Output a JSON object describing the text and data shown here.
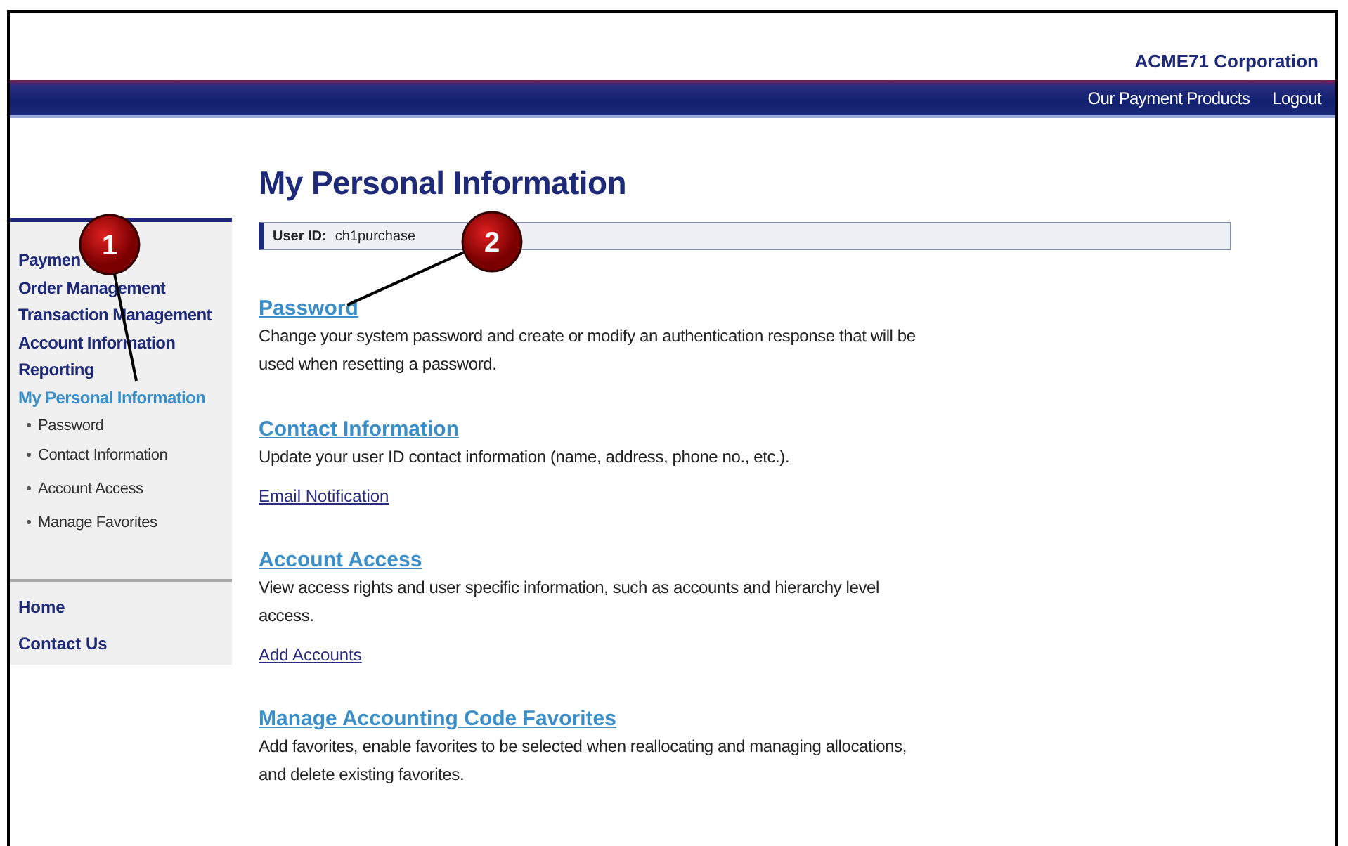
{
  "header": {
    "company": "ACME71 Corporation",
    "links": [
      "Our Payment Products",
      "Logout"
    ]
  },
  "sidebar": {
    "items": [
      {
        "label": "Paymen",
        "selected": false
      },
      {
        "label": "Order Management",
        "selected": false
      },
      {
        "label": "Transaction Management",
        "selected": false
      },
      {
        "label": "Account Information",
        "selected": false
      },
      {
        "label": "Reporting",
        "selected": false
      },
      {
        "label": "My Personal Information",
        "selected": true,
        "children": [
          "Password",
          "Contact Information",
          "Account Access",
          "Manage Favorites"
        ]
      }
    ],
    "bottom_links": [
      "Home",
      "Contact Us"
    ]
  },
  "main": {
    "title": "My Personal Information",
    "user_id_label": "User ID:",
    "user_id": "ch1purchase",
    "sections": [
      {
        "heading": "Password",
        "description": "Change your system password and create or modify an authentication response that will be used when resetting a password."
      },
      {
        "heading": "Contact Information",
        "description": "Update your user ID contact information (name, address, phone no., etc.).",
        "links": [
          "Email Notification"
        ]
      },
      {
        "heading": "Account Access",
        "description": "View access rights and user specific information, such as accounts and hierarchy level access.",
        "links": [
          "Add Accounts"
        ]
      },
      {
        "heading": "Manage Accounting Code Favorites",
        "description": "Add favorites, enable favorites to be selected when reallocating and managing allocations, and delete existing favorites."
      }
    ]
  },
  "callouts": [
    "1",
    "2"
  ]
}
